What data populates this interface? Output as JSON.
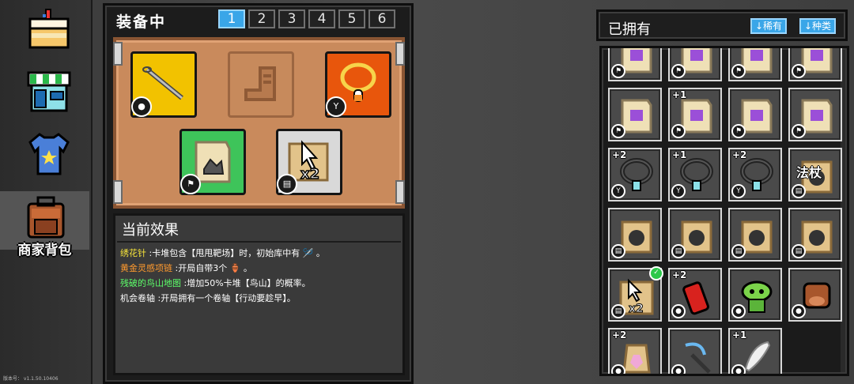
{
  "sidebar": {
    "items": [
      {
        "name": "cake",
        "icon": "cake-icon",
        "label": ""
      },
      {
        "name": "shop",
        "icon": "shop-icon",
        "label": ""
      },
      {
        "name": "clothing",
        "icon": "tshirt-icon",
        "label": ""
      },
      {
        "name": "backpack",
        "icon": "backpack-icon",
        "label": "商家背包",
        "active": true
      }
    ],
    "version": "版本号：   v1.1.50.10406"
  },
  "equipped": {
    "title": "装备中",
    "pages": [
      "1",
      "2",
      "3",
      "4",
      "5",
      "6"
    ],
    "active_page": "1",
    "slots": [
      {
        "name": "embroidery-needle",
        "icon": "needle-icon",
        "bg": "#f2c200"
      },
      {
        "name": "empty-boot-slot",
        "icon": "boot-icon",
        "bg": "#c78a5c"
      },
      {
        "name": "golden-necklace",
        "icon": "necklace-icon",
        "bg": "#e8560c"
      },
      {
        "name": "broken-bird-mountain-map",
        "icon": "map-icon",
        "bg": "#3ec45a"
      },
      {
        "name": "chance-scroll",
        "icon": "cursor-x2-icon",
        "bg": "#d9d9d9"
      }
    ]
  },
  "effects": {
    "title": "当前效果",
    "lines": [
      {
        "name": "绣花针",
        "color": "#f7e43a",
        "text": " :卡堆包含【甩甩靶场】时，初始库中有 🪡 。"
      },
      {
        "name": "黄金灵感项链",
        "color": "#ff9a2e",
        "text": " :开局自带3个 🏺 。"
      },
      {
        "name": "残破的鸟山地图",
        "color": "#5dff6a",
        "text": " :增加50%卡堆【鸟山】的概率。"
      },
      {
        "name": "机会卷轴",
        "color": "#ffffff",
        "text": " :开局拥有一个卷轴【行动要趁早】。"
      }
    ]
  },
  "owned": {
    "title": "已拥有",
    "sort_rarity": "↓稀有",
    "sort_type": "↓种类",
    "items": [
      {
        "name": "map-top-1",
        "lvl": "",
        "icon": "map-icon",
        "badge": "flag"
      },
      {
        "name": "map-top-2",
        "lvl": "",
        "icon": "map-icon",
        "badge": "flag"
      },
      {
        "name": "map-top-3",
        "lvl": "",
        "icon": "map-icon",
        "badge": "flag"
      },
      {
        "name": "map-top-4",
        "lvl": "",
        "icon": "map-icon",
        "badge": "flag"
      },
      {
        "name": "map-red",
        "lvl": "",
        "icon": "map-icon",
        "badge": "flag"
      },
      {
        "name": "map-purple",
        "lvl": "+1",
        "icon": "map-icon",
        "badge": "flag"
      },
      {
        "name": "map-blue",
        "lvl": "",
        "icon": "map-icon",
        "badge": "flag"
      },
      {
        "name": "map-teal",
        "lvl": "",
        "icon": "map-icon",
        "badge": "flag"
      },
      {
        "name": "heart-necklace",
        "lvl": "+2",
        "icon": "necklace-icon",
        "badge": "necklace"
      },
      {
        "name": "x2-necklace",
        "lvl": "+1",
        "icon": "necklace-icon",
        "badge": "necklace"
      },
      {
        "name": "crystal-necklace",
        "lvl": "+2",
        "icon": "necklace-icon",
        "badge": "necklace"
      },
      {
        "name": "staff-scroll",
        "lvl": "",
        "icon": "scroll-icon",
        "badge": "book",
        "text": "法杖"
      },
      {
        "name": "bomb-scroll",
        "lvl": "",
        "icon": "scroll-icon",
        "badge": "book"
      },
      {
        "name": "feather-scroll",
        "lvl": "",
        "icon": "scroll-icon",
        "badge": "book"
      },
      {
        "name": "bun-scroll",
        "lvl": "",
        "icon": "scroll-icon",
        "badge": "book"
      },
      {
        "name": "chick-scroll",
        "lvl": "",
        "icon": "scroll-icon",
        "badge": "book"
      },
      {
        "name": "chance-scroll-owned",
        "lvl": "",
        "icon": "cursor-x2-icon",
        "badge": "book",
        "check": true
      },
      {
        "name": "firecracker",
        "lvl": "+2",
        "icon": "firecracker-icon",
        "badge": "needle"
      },
      {
        "name": "goblin-doll",
        "lvl": "",
        "icon": "goblin-icon",
        "badge": "needle"
      },
      {
        "name": "boar-doll",
        "lvl": "",
        "icon": "boar-icon",
        "badge": "needle"
      },
      {
        "name": "crystal-bag",
        "lvl": "+2",
        "icon": "bag-icon",
        "badge": "needle"
      },
      {
        "name": "moon-wand",
        "lvl": "",
        "icon": "wand-icon",
        "badge": "needle"
      },
      {
        "name": "white-feather",
        "lvl": "+1",
        "icon": "feather-icon",
        "badge": "needle"
      }
    ]
  }
}
